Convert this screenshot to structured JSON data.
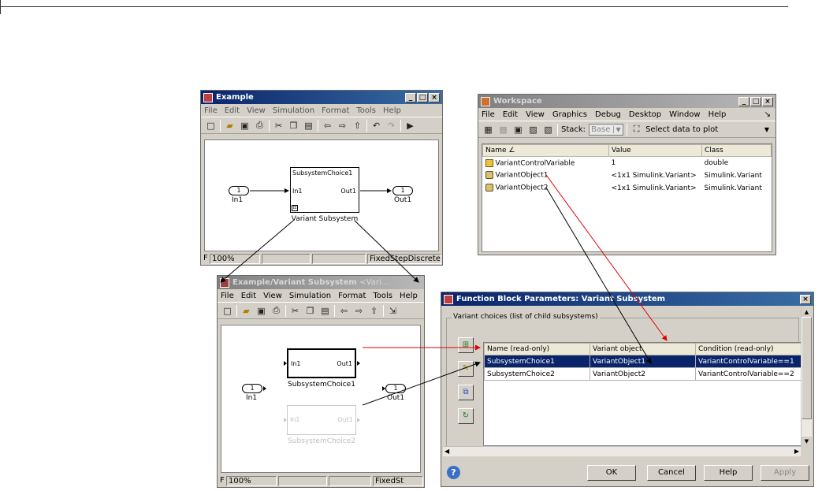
{
  "example_window": {
    "title": "Example",
    "menu": [
      "File",
      "Edit",
      "View",
      "Simulation",
      "Format",
      "Tools",
      "Help"
    ],
    "blocks": {
      "in1_num": "1",
      "in1_label": "In1",
      "out1_num": "1",
      "out1_label": "Out1",
      "subsystem_title": "SubsystemChoice1",
      "subsystem_in": "In1",
      "subsystem_out": "Out1",
      "subsystem_label": "Variant Subsystem"
    },
    "status": {
      "left": "F",
      "zoom": "100%",
      "solver": "FixedStepDiscrete"
    }
  },
  "variant_window": {
    "title": "Example/Variant Subsystem",
    "title_tail": "<Vari...",
    "menu": [
      "File",
      "Edit",
      "View",
      "Simulation",
      "Format",
      "Tools",
      "Help"
    ],
    "blocks": {
      "in1_num": "1",
      "in1_label": "In1",
      "out1_num": "1",
      "out1_label": "Out1",
      "choice1_in": "In1",
      "choice1_out": "Out1",
      "choice1_label": "SubsystemChoice1",
      "choice2_in": "In1",
      "choice2_out": "Out1",
      "choice2_label": "SubsystemChoice2"
    },
    "status": {
      "left": "F",
      "zoom": "100%",
      "solver": "FixedSt"
    }
  },
  "workspace_window": {
    "title": "Workspace",
    "menu": [
      "File",
      "Edit",
      "View",
      "Graphics",
      "Debug",
      "Desktop",
      "Window",
      "Help"
    ],
    "stack_label": "Stack:",
    "stack_value": "Base",
    "select_plot": "Select data to plot",
    "columns": [
      "Name ∠",
      "Value",
      "Class"
    ],
    "rows": [
      {
        "name": "VariantControlVariable",
        "value": "1",
        "class": "double",
        "icon": "grid-variable-icon"
      },
      {
        "name": "VariantObject1",
        "value": "<1x1 Simulink.Variant>",
        "class": "Simulink.Variant",
        "icon": "object-cube-icon"
      },
      {
        "name": "VariantObject2",
        "value": "<1x1 Simulink.Variant>",
        "class": "Simulink.Variant",
        "icon": "object-cube-icon"
      }
    ]
  },
  "params_dialog": {
    "title": "Function Block Parameters: Variant Subsystem",
    "group_label": "Variant choices (list of child subsystems)",
    "columns": [
      "Name (read-only)",
      "Variant object",
      "Condition (read-only)"
    ],
    "rows": [
      {
        "name": "SubsystemChoice1",
        "object": "VariantObject1",
        "condition": "VariantControlVariable==1",
        "selected": true
      },
      {
        "name": "SubsystemChoice2",
        "object": "VariantObject2",
        "condition": "VariantControlVariable==2",
        "selected": false
      }
    ],
    "buttons": {
      "ok": "OK",
      "cancel": "Cancel",
      "help": "Help",
      "apply": "Apply"
    }
  },
  "colors": {
    "title_active": "#0a246a",
    "selection": "#0a246a",
    "red_arrow": "#e00000",
    "black_arrow": "#000000"
  }
}
